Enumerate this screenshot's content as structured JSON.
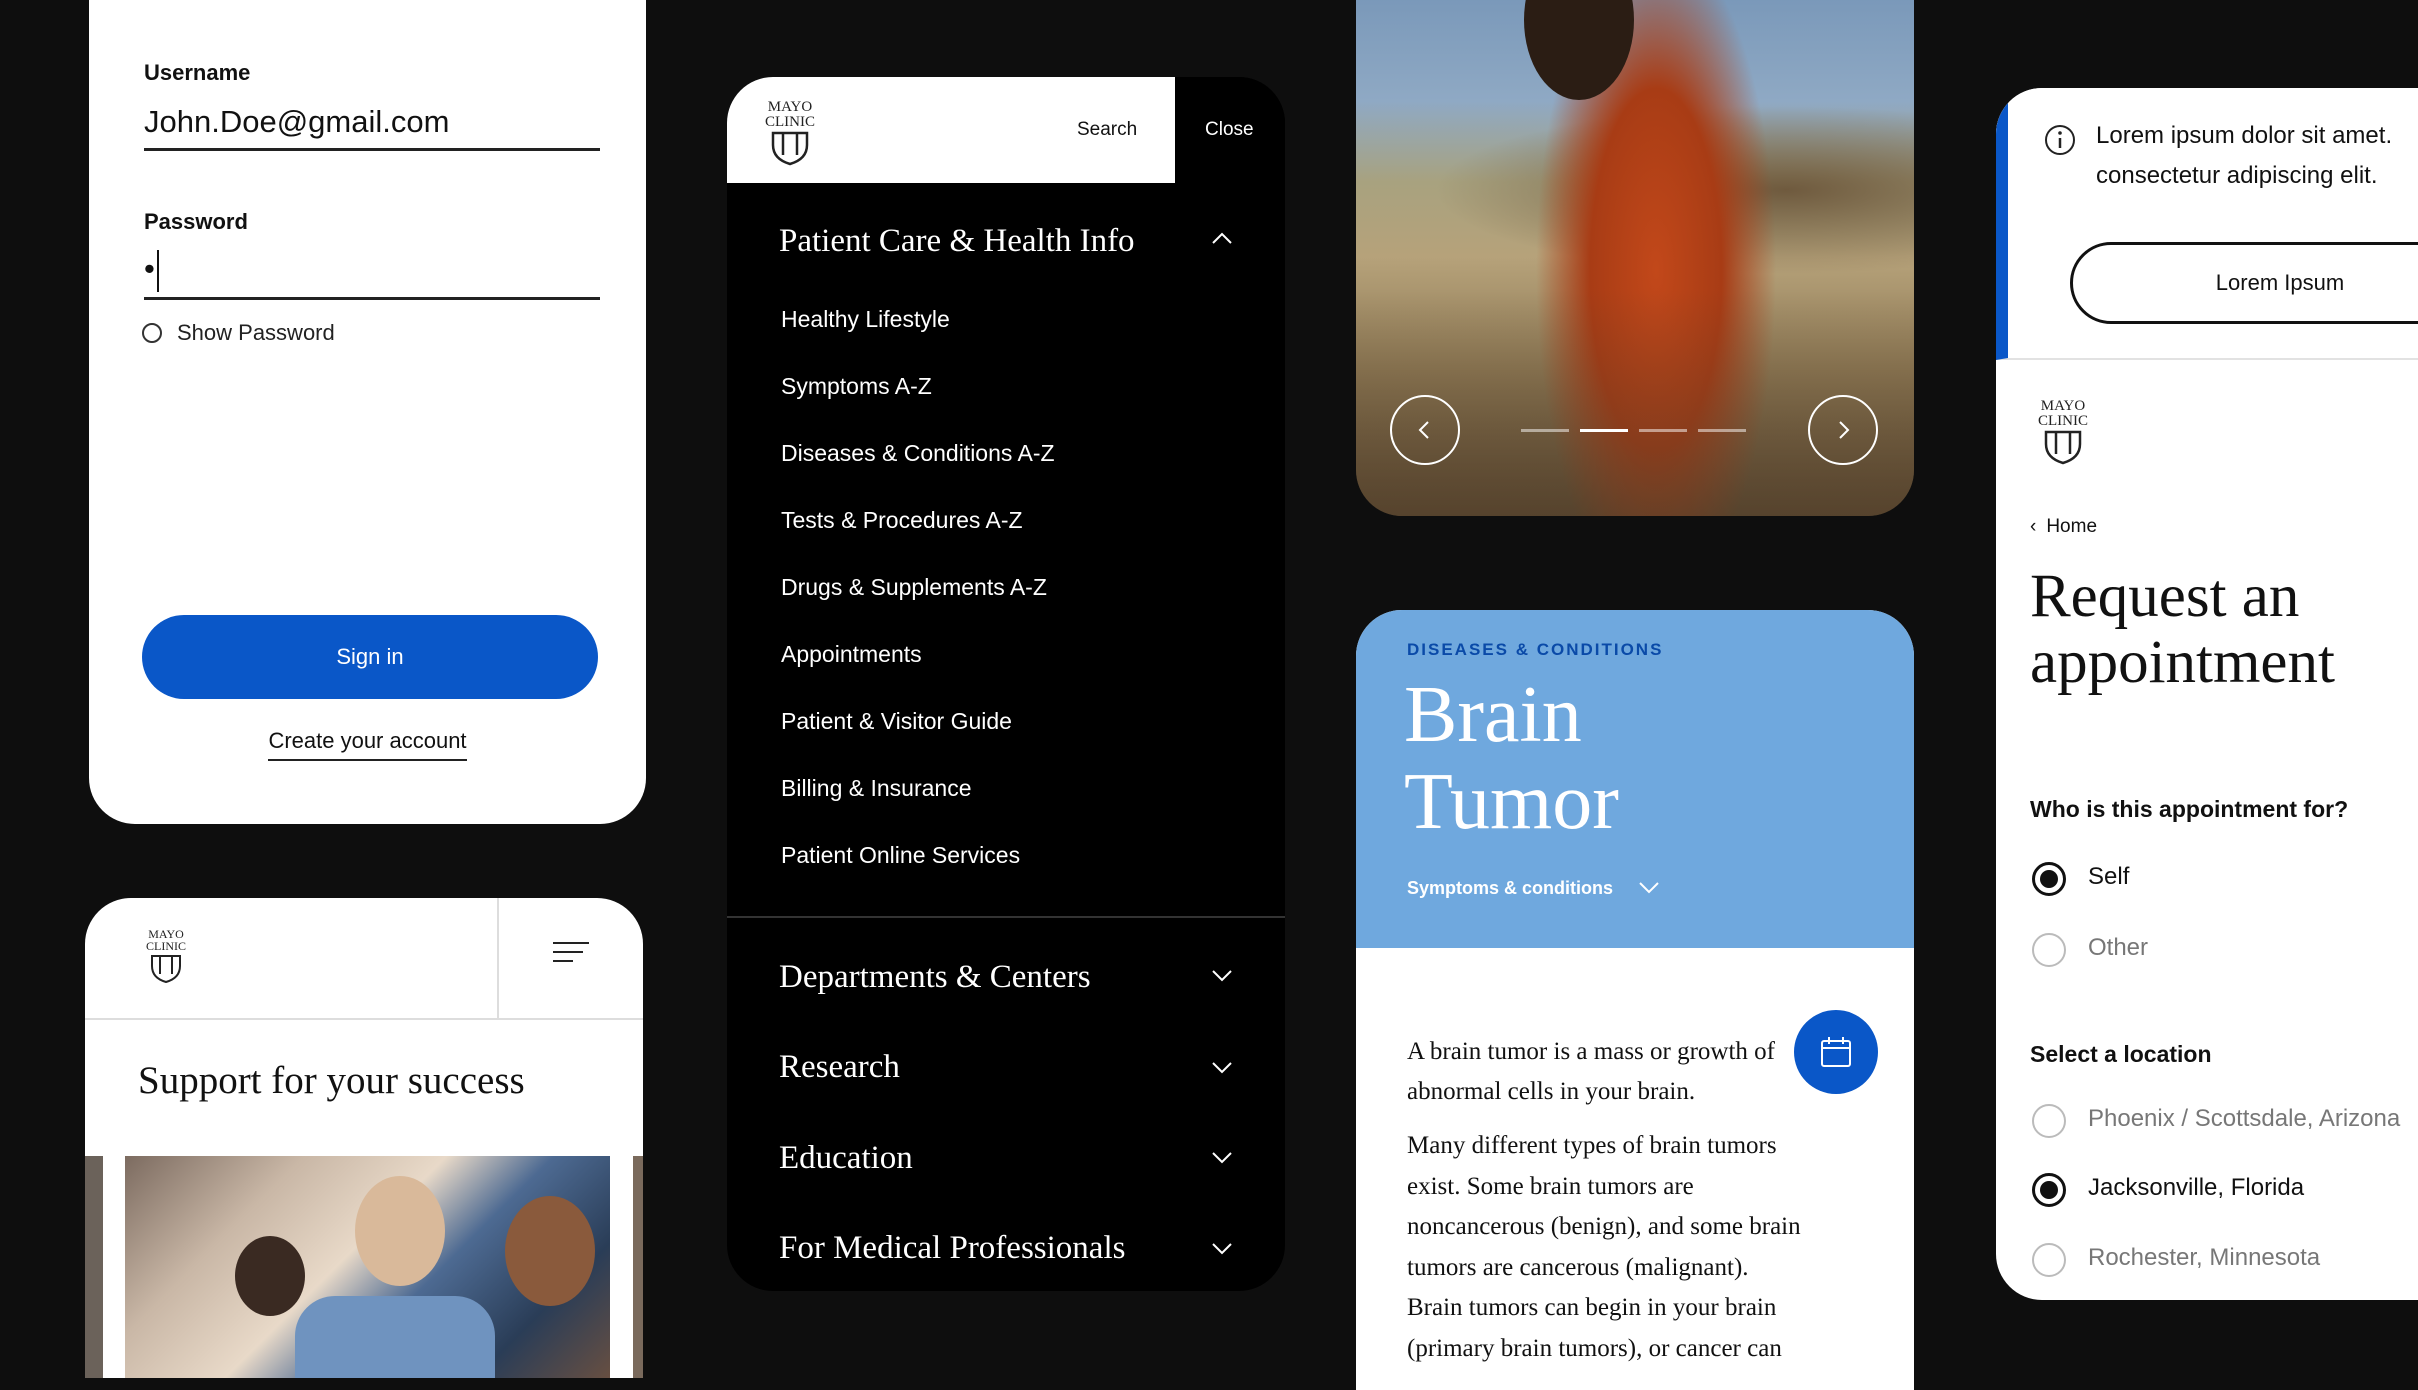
{
  "login": {
    "username_label": "Username",
    "username_value": "John.Doe@gmail.com",
    "password_label": "Password",
    "password_value": "•",
    "show_password": "Show Password",
    "sign_in": "Sign in",
    "create_account": "Create your account"
  },
  "support": {
    "title": "Support for your success",
    "logo_line1": "MAYO",
    "logo_line2": "CLINIC"
  },
  "nav": {
    "logo_line1": "MAYO",
    "logo_line2": "CLINIC",
    "search": "Search",
    "close": "Close",
    "open_section": "Patient Care & Health Info",
    "items": [
      "Healthy Lifestyle",
      "Symptoms A-Z",
      "Diseases & Conditions A-Z",
      "Tests & Procedures A-Z",
      "Drugs & Supplements A-Z",
      "Appointments",
      "Patient & Visitor Guide",
      "Billing & Insurance",
      "Patient Online Services"
    ],
    "sections": [
      "Departments & Centers",
      "Research",
      "Education",
      "For Medical Professionals"
    ]
  },
  "hero": {
    "slides_total": 4,
    "active_slide": 2
  },
  "brain": {
    "category": "DISEASES & CONDITIONS",
    "title_line1": "Brain",
    "title_line2": "Tumor",
    "subnav": "Symptoms & conditions",
    "para1_line1": "A brain tumor is a mass or growth of",
    "para1_line2": "abnormal cells in your brain.",
    "para2_lines": [
      "Many different types of brain tumors",
      "exist. Some brain tumors are",
      "noncancerous (benign), and some brain",
      "tumors are cancerous (malignant).",
      "Brain tumors can begin in your brain",
      "(primary brain tumors), or cancer can"
    ]
  },
  "appointment": {
    "alert_line1": "Lorem ipsum dolor sit amet.",
    "alert_line2": "consectetur adipiscing elit.",
    "alert_button": "Lorem Ipsum",
    "logo_line1": "MAYO",
    "logo_line2": "CLINIC",
    "breadcrumb": "Home",
    "title_line1": "Request an",
    "title_line2": "appointment",
    "who_question": "Who is this appointment for?",
    "who_options": [
      "Self",
      "Other"
    ],
    "who_selected": "Self",
    "location_question": "Select a location",
    "locations": [
      "Phoenix / Scottsdale, Arizona",
      "Jacksonville, Florida",
      "Rochester, Minnesota"
    ],
    "location_selected": "Jacksonville, Florida"
  },
  "colors": {
    "brand_blue": "#0a57c8",
    "hero_blue": "#6fa8de",
    "background": "#0e0e0e"
  }
}
